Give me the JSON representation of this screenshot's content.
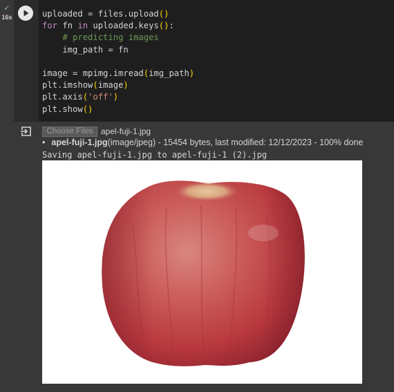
{
  "cell": {
    "exec_time": "16s",
    "status_icon": "check-icon",
    "run_icon": "play-icon",
    "code": [
      [
        {
          "t": "uploaded = files.upload",
          "c": "var"
        },
        {
          "t": "()",
          "c": "par"
        }
      ],
      [
        {
          "t": "for",
          "c": "kw"
        },
        {
          "t": " fn ",
          "c": "var"
        },
        {
          "t": "in",
          "c": "kw"
        },
        {
          "t": " uploaded.keys",
          "c": "var"
        },
        {
          "t": "()",
          "c": "par"
        },
        {
          "t": ":",
          "c": "var"
        }
      ],
      [
        {
          "t": "    ",
          "c": "var"
        },
        {
          "t": "# predicting images",
          "c": "cmt"
        }
      ],
      [
        {
          "t": "    img_path = fn",
          "c": "var"
        }
      ],
      [
        {
          "t": "",
          "c": "var"
        }
      ],
      [
        {
          "t": "image = mpimg.imread",
          "c": "var"
        },
        {
          "t": "(",
          "c": "par"
        },
        {
          "t": "img_path",
          "c": "var"
        },
        {
          "t": ")",
          "c": "par"
        }
      ],
      [
        {
          "t": "plt.imshow",
          "c": "var"
        },
        {
          "t": "(",
          "c": "par"
        },
        {
          "t": "image",
          "c": "var"
        },
        {
          "t": ")",
          "c": "par"
        }
      ],
      [
        {
          "t": "plt.axis",
          "c": "var"
        },
        {
          "t": "(",
          "c": "par"
        },
        {
          "t": "'off'",
          "c": "str"
        },
        {
          "t": ")",
          "c": "par"
        }
      ],
      [
        {
          "t": "plt.show",
          "c": "var"
        },
        {
          "t": "()",
          "c": "par"
        }
      ]
    ]
  },
  "output": {
    "output_icon": "output-icon",
    "choose_files_label": "Choose Files",
    "selected_file": "apel-fuji-1.jpg",
    "file_info": {
      "bullet": "•",
      "name": "apel-fuji-1.jpg",
      "details": "(image/jpeg) - 15454 bytes, last modified: 12/12/2023 - 100% done"
    },
    "saving_text": "Saving apel-fuji-1.jpg to apel-fuji-1 (2).jpg",
    "plot_image": "red-fuji-apple-image"
  }
}
